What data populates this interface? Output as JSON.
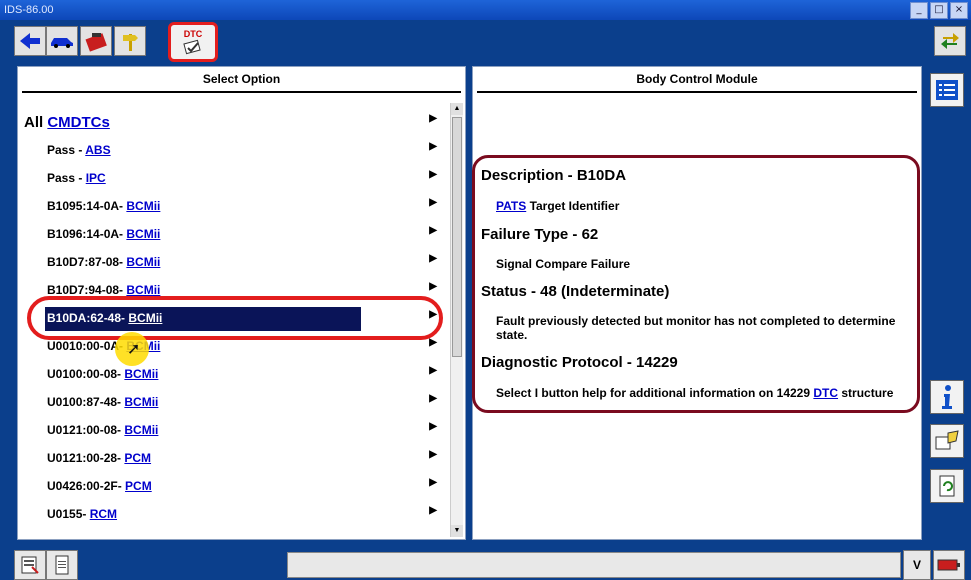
{
  "window": {
    "title": "IDS-86.00",
    "min": "_",
    "max": "□",
    "close": "×"
  },
  "toolbar": {
    "dtc_label": "DTC"
  },
  "left_panel": {
    "title": "Select Option",
    "rows": [
      {
        "prefix": "All",
        "link": "CMDTCs"
      },
      {
        "prefix": "Pass - ",
        "link": "ABS"
      },
      {
        "prefix": "Pass - ",
        "link": "IPC"
      },
      {
        "prefix": "B1095:14-0A- ",
        "link": "BCMii"
      },
      {
        "prefix": "B1096:14-0A- ",
        "link": "BCMii"
      },
      {
        "prefix": "B10D7:87-08- ",
        "link": "BCMii"
      },
      {
        "prefix": "B10D7:94-08- ",
        "link": "BCMii"
      },
      {
        "prefix": "B10DA:62-48- ",
        "link": "BCMii"
      },
      {
        "prefix": "U0010:00-0A- ",
        "link": "BCMii"
      },
      {
        "prefix": "U0100:00-08- ",
        "link": "BCMii"
      },
      {
        "prefix": "U0100:87-48- ",
        "link": "BCMii"
      },
      {
        "prefix": "U0121:00-08- ",
        "link": "BCMii"
      },
      {
        "prefix": "U0121:00-28- ",
        "link": "PCM"
      },
      {
        "prefix": "U0426:00-2F- ",
        "link": "PCM"
      },
      {
        "prefix": "U0155- ",
        "link": "RCM"
      }
    ],
    "arrow": "▶"
  },
  "right_panel": {
    "title": "Body Control Module",
    "description_title": "Description - B10DA",
    "description_link": "PATS",
    "description_text": " Target Identifier",
    "failure_title": "Failure Type - 62",
    "failure_text": "Signal Compare Failure",
    "status_title": "Status - 48 (Indeterminate)",
    "status_text": "Fault previously detected but monitor has not completed to determine state.",
    "protocol_title": "Diagnostic Protocol - 14229",
    "protocol_text_a": "Select I button help for additional information on 14229 ",
    "protocol_link": "DTC",
    "protocol_text_b": " structure"
  },
  "statusbar": {
    "v_label": "V"
  },
  "colors": {
    "accent": "#0b3f8c",
    "highlight": "#0a1458",
    "annotation_red": "#e31d1d",
    "link": "#0000cc"
  }
}
